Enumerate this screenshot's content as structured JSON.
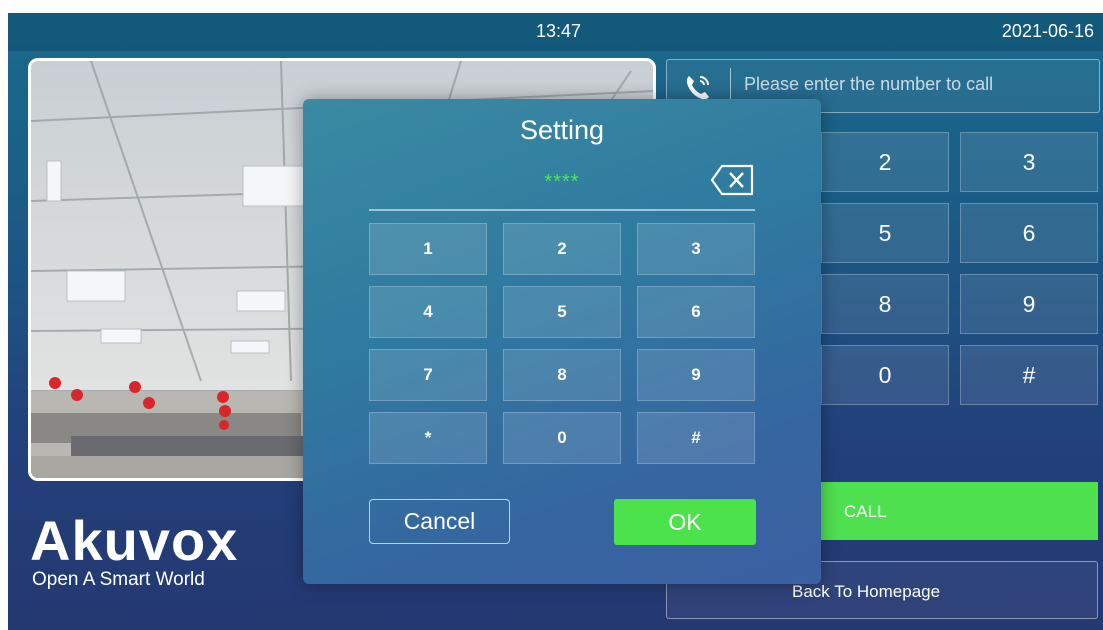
{
  "status_bar": {
    "time": "13:47",
    "date": "2021-06-16"
  },
  "brand": {
    "name": "Akuvox",
    "tagline": "Open A Smart World"
  },
  "dialpad": {
    "placeholder": "Please enter the number to call",
    "visible_keys": [
      "2",
      "3",
      "5",
      "6",
      "8",
      "9",
      "0",
      "#"
    ],
    "call_label": "CALL",
    "home_label": "Back To Homepage"
  },
  "dialog": {
    "title": "Setting",
    "pin_masked": "****",
    "keys": [
      "1",
      "2",
      "3",
      "4",
      "5",
      "6",
      "7",
      "8",
      "9",
      "*",
      "0",
      "#"
    ],
    "cancel_label": "Cancel",
    "ok_label": "OK"
  },
  "colors": {
    "accent_green": "#4be24b",
    "pin_green": "#4de65a"
  },
  "icons": [
    "phone-call-icon",
    "backspace-icon"
  ]
}
